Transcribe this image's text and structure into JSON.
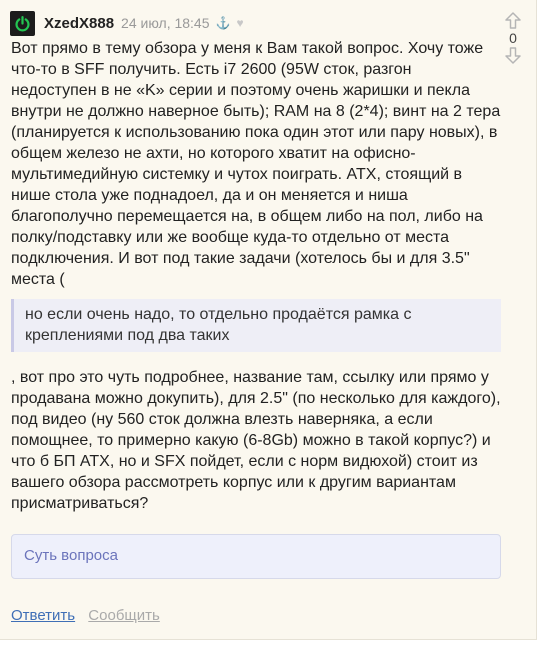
{
  "comment": {
    "username": "XzedX888",
    "date": "24 июл, 18:45",
    "vote_count": "0",
    "paragraph1": "Вот прямо в тему обзора у меня к Вам такой вопрос. Хочу тоже что-то в SFF получить. Есть i7 2600 (95W сток, разгон недоступен в не «K» серии и поэтому очень жаришки и пекла внутри не должно наверное быть); RAM на 8 (2*4); винт на 2 тера (планируется к использованию пока один этот или пару новых), в общем железо не ахти, но которого хватит на офисно-мультимедийную системку и чутох поиграть. ATX, стоящий в нише стола уже поднадоел, да и он меняется и ниша благополучно перемещается на, в общем либо на пол, либо на полку/подставку или же вообще куда-то отдельно от места подключения. И вот под такие задачи (хотелось бы и для 3.5\" места (",
    "quote": "но если очень надо, то отдельно продаётся рамка с креплениями под два таких",
    "paragraph2": ", вот про это чуть подробнее, название там, ссылку или прямо у продавана можно докупить), для 2.5\" (по несколько для каждого), под видео (ну 560 сток должна влезть наверняка, а если помощнее, то примерно какую (6-8Gb) можно в такой корпус?) и что б БП ATX, но и SFX пойдет, если с норм видюхой) стоит из вашего обзора рассмотреть корпус или к другим вариантам присматриваться?",
    "answer_label": "Суть вопроса",
    "reply_label": "Ответить",
    "report_label": "Сообщить"
  },
  "icons": {
    "avatar": "power-icon",
    "anchor": "anchor-icon",
    "heart": "heart-icon",
    "vote_up": "arrow-up-icon",
    "vote_down": "arrow-down-icon"
  },
  "colors": {
    "background": "#fbf8ef",
    "link": "#3f6fb6",
    "muted": "#aaaaaa",
    "quote_bg": "#eeeef6",
    "answer_text": "#6b74bb",
    "avatar_glyph": "#23c552"
  }
}
